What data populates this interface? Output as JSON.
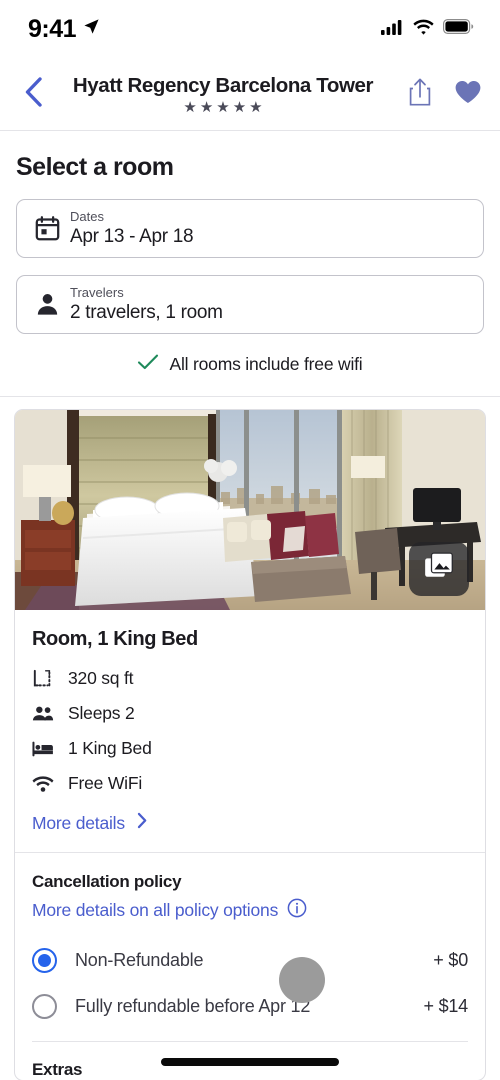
{
  "status_bar": {
    "time": "9:41",
    "location_icon": "location-arrow-icon",
    "cellular_icon": "cellular-bars-icon",
    "wifi_icon": "wifi-icon",
    "battery_icon": "battery-full-icon"
  },
  "nav": {
    "back_icon": "chevron-left-icon",
    "title": "Hyatt Regency Barcelona Tower",
    "star_glyph": "★",
    "star_count": 5,
    "share_icon": "share-icon",
    "favorite_icon": "heart-filled-icon"
  },
  "page": {
    "heading": "Select a room"
  },
  "fields": {
    "dates": {
      "icon": "calendar-icon",
      "label": "Dates",
      "value": "Apr 13 - Apr 18"
    },
    "travelers": {
      "icon": "person-icon",
      "label": "Travelers",
      "value": "2 travelers, 1 room"
    }
  },
  "wifi_note": {
    "icon": "check-icon",
    "text": "All rooms include free wifi",
    "color": "#1f8a5b"
  },
  "room_card": {
    "photo_alt": "hotel-room-photo",
    "gallery_button_icon": "photo-library-icon",
    "title": "Room, 1 King Bed",
    "amenities": [
      {
        "icon": "area-icon",
        "label": "320 sq ft"
      },
      {
        "icon": "people-icon",
        "label": "Sleeps 2"
      },
      {
        "icon": "bed-icon",
        "label": "1 King Bed"
      },
      {
        "icon": "wifi-icon",
        "label": "Free WiFi"
      }
    ],
    "more_details": {
      "label": "More details",
      "chevron_icon": "chevron-right-icon"
    }
  },
  "cancellation_policy": {
    "title": "Cancellation policy",
    "link_text": "More details on all policy options",
    "info_icon": "info-circle-icon",
    "options": [
      {
        "label": "Non-Refundable",
        "price": "+ $0",
        "selected": true
      },
      {
        "label": "Fully refundable before Apr 12",
        "price": "+ $14",
        "selected": false
      }
    ]
  },
  "extras": {
    "title": "Extras"
  },
  "theme": {
    "link_blue": "#4a5dcd",
    "radio_blue": "#2563eb",
    "text_dark": "#1c1b20",
    "border_gray": "#c3c3cb",
    "check_green": "#1f8a5b"
  },
  "cursor": {
    "name": "mouse-cursor"
  },
  "home_indicator": {
    "name": "home-indicator"
  }
}
